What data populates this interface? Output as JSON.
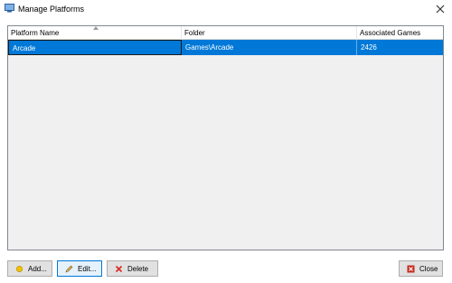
{
  "window": {
    "title": "Manage Platforms"
  },
  "columns": [
    "Platform Name",
    "Folder",
    "Associated Games"
  ],
  "rows": [
    {
      "platform_name": "Arcade",
      "folder": "Games\\Arcade",
      "associated_games": "2426"
    }
  ],
  "buttons": {
    "add": "Add...",
    "edit": "Edit...",
    "delete": "Delete",
    "close": "Close"
  },
  "colors": {
    "selection": "#0078d7",
    "delete_icon": "#d9302c",
    "close_icon": "#c42b1c"
  }
}
